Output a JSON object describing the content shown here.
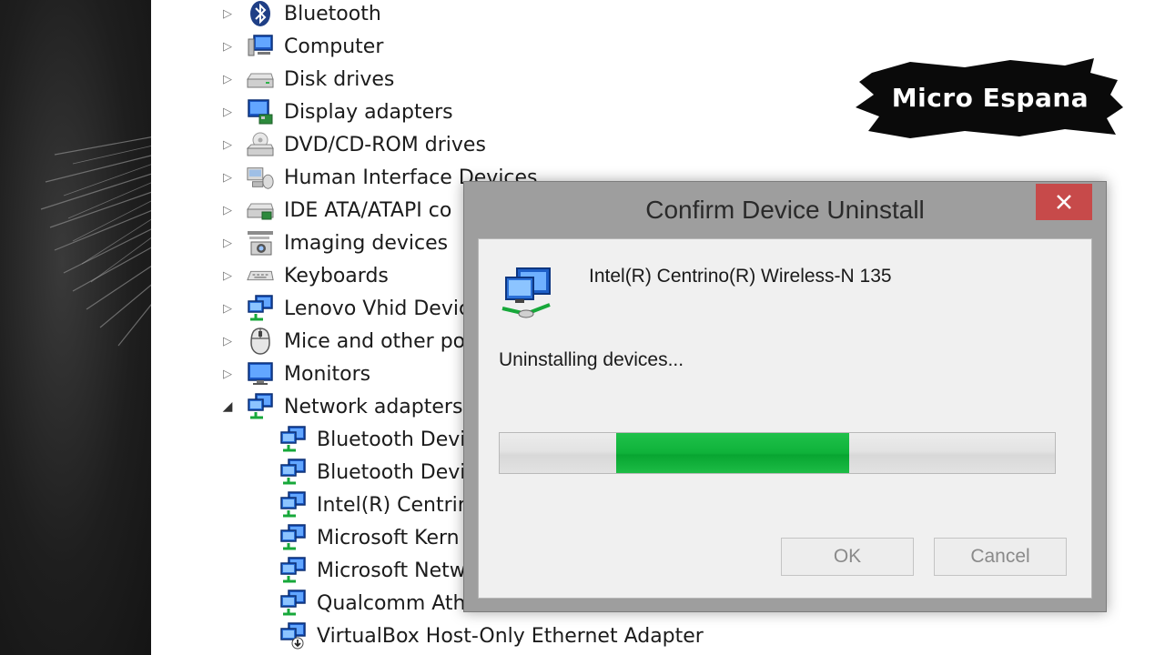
{
  "device_manager": {
    "items": [
      {
        "label": "Bluetooth",
        "expanded": false,
        "icon": "bluetooth-icon"
      },
      {
        "label": "Computer",
        "expanded": false,
        "icon": "computer-icon"
      },
      {
        "label": "Disk drives",
        "expanded": false,
        "icon": "disk-drive-icon"
      },
      {
        "label": "Display adapters",
        "expanded": false,
        "icon": "display-adapter-icon"
      },
      {
        "label": "DVD/CD-ROM drives",
        "expanded": false,
        "icon": "dvd-drive-icon"
      },
      {
        "label": "Human Interface Devices",
        "expanded": false,
        "icon": "hid-icon"
      },
      {
        "label": "IDE ATA/ATAPI co",
        "expanded": false,
        "icon": "ide-controller-icon"
      },
      {
        "label": "Imaging devices",
        "expanded": false,
        "icon": "camera-icon"
      },
      {
        "label": "Keyboards",
        "expanded": false,
        "icon": "keyboard-icon"
      },
      {
        "label": "Lenovo Vhid Devic",
        "expanded": false,
        "icon": "network-icon"
      },
      {
        "label": "Mice and other poi",
        "expanded": false,
        "icon": "mouse-icon"
      },
      {
        "label": "Monitors",
        "expanded": false,
        "icon": "monitor-icon"
      },
      {
        "label": "Network adapters",
        "expanded": true,
        "icon": "network-icon"
      }
    ],
    "network_children": [
      {
        "label": "Bluetooth Devic",
        "icon": "network-icon"
      },
      {
        "label": "Bluetooth Devic",
        "icon": "network-icon"
      },
      {
        "label": "Intel(R) Centrin",
        "icon": "network-icon"
      },
      {
        "label": "Microsoft Kern",
        "icon": "network-icon"
      },
      {
        "label": "Microsoft Netw",
        "icon": "network-icon"
      },
      {
        "label": "Qualcomm Ath",
        "icon": "network-icon"
      },
      {
        "label": "VirtualBox Host-Only Ethernet Adapter",
        "icon": "network-install-icon"
      }
    ]
  },
  "logo": {
    "text": "Micro Espana"
  },
  "dialog": {
    "title": "Confirm Device Uninstall",
    "device_name": "Intel(R) Centrino(R) Wireless-N 135",
    "status": "Uninstalling devices...",
    "progress": {
      "start": 0.21,
      "end": 0.63
    },
    "ok_label": "OK",
    "cancel_label": "Cancel",
    "colors": {
      "close": "#c74a4a",
      "progress": "#0fb23a"
    }
  }
}
